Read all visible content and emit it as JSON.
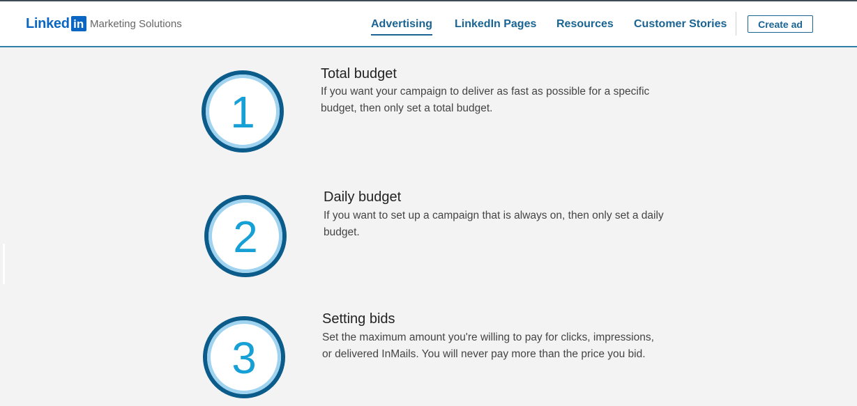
{
  "header": {
    "logo_word": "Linked",
    "logo_in": "in",
    "subtitle": "Marketing Solutions",
    "nav": [
      {
        "label": "Advertising",
        "active": true
      },
      {
        "label": "LinkedIn Pages",
        "active": false
      },
      {
        "label": "Resources",
        "active": false
      },
      {
        "label": "Customer Stories",
        "active": false
      }
    ],
    "cta_label": "Create ad"
  },
  "colors": {
    "brand_blue": "#0a66c2",
    "nav_blue": "#1a6493",
    "circle_dark": "#0b5c8a",
    "circle_light": "#9fd3ef",
    "number_cyan": "#16a0d6",
    "page_bg": "#f3f3f3"
  },
  "steps": [
    {
      "number": "1",
      "title": "Total budget",
      "desc": "If you want your campaign to deliver as fast as possible for a specific budget, then only set a total budget."
    },
    {
      "number": "2",
      "title": "Daily budget",
      "desc": "If you want to set up a campaign that is always on, then only set a daily budget."
    },
    {
      "number": "3",
      "title": "Setting bids",
      "desc": "Set the maximum amount you're willing to pay for clicks, impressions, or delivered InMails. You will never pay more than the price you bid."
    }
  ]
}
